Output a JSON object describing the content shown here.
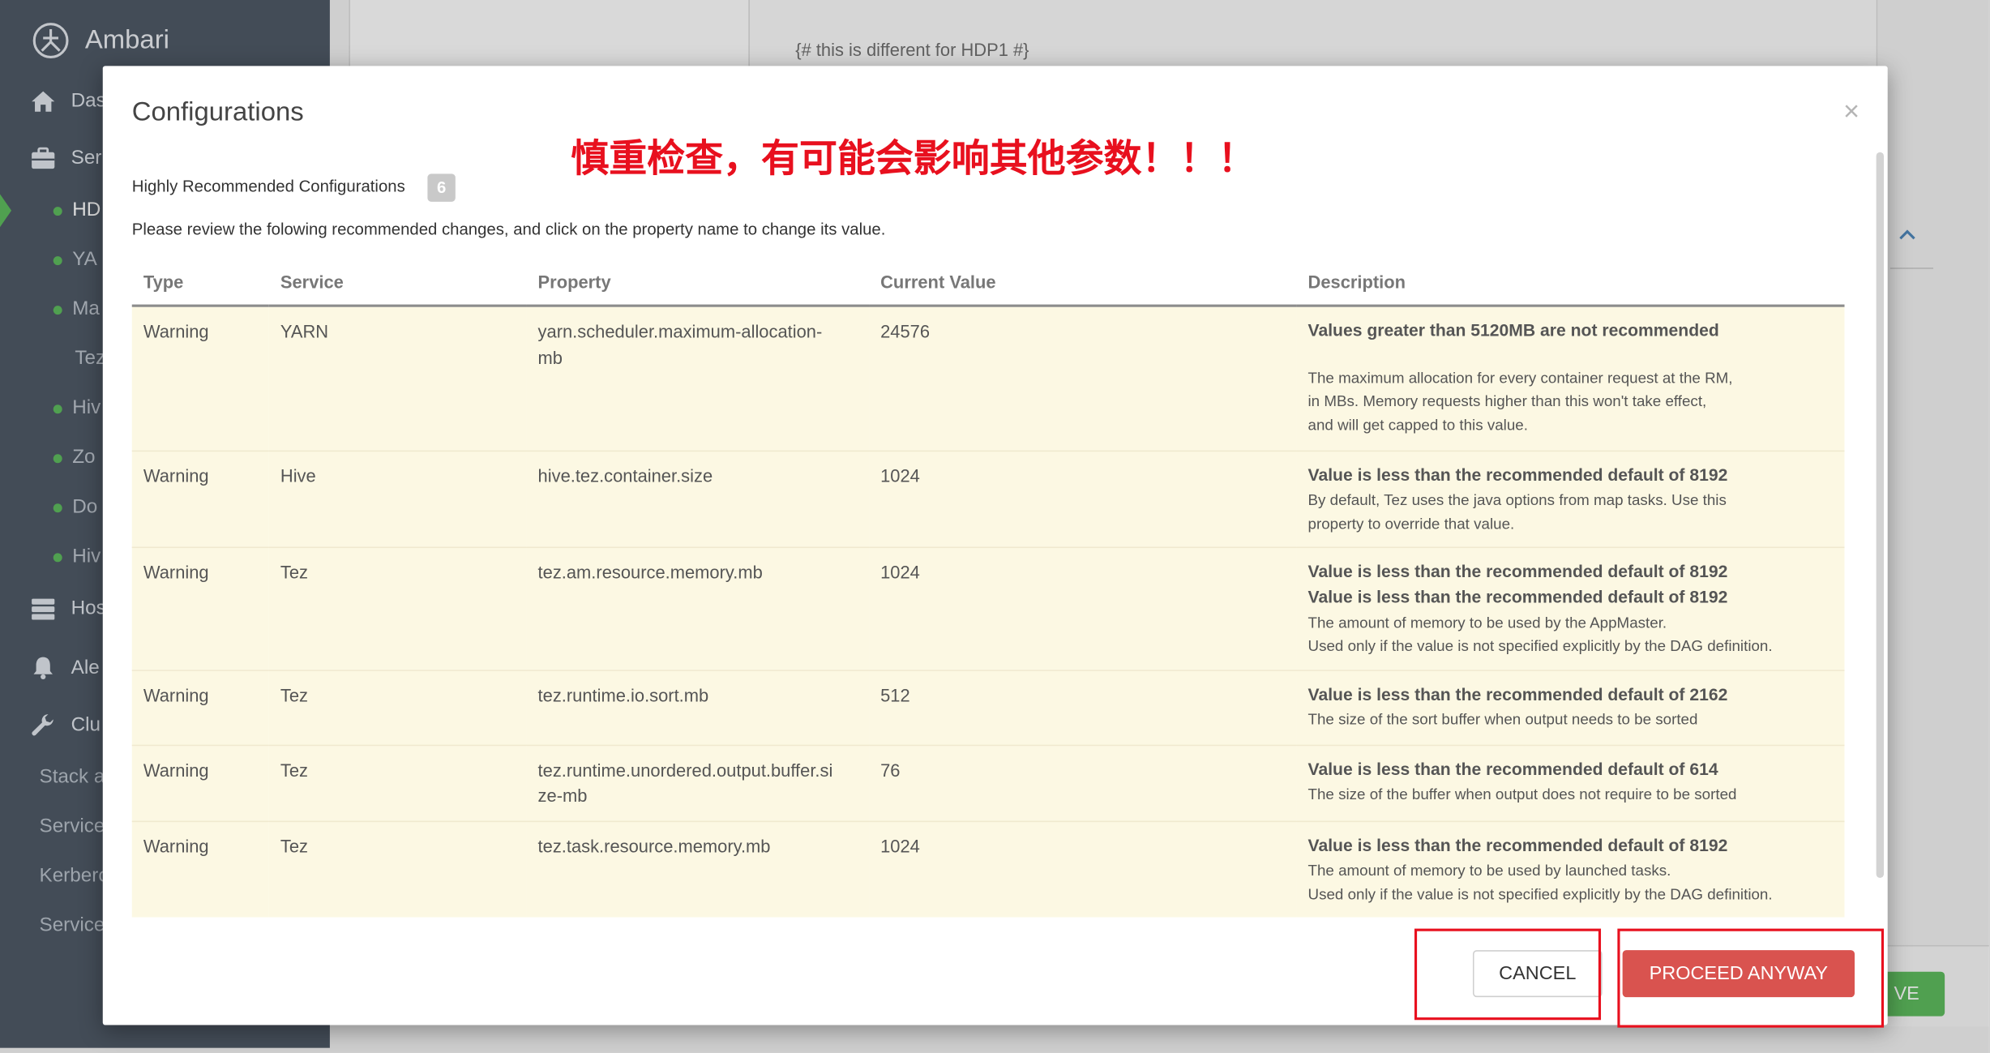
{
  "app": {
    "name": "Ambari"
  },
  "sidebar": {
    "dashboard": "Das",
    "services": "Ser",
    "service_list": [
      "HD",
      "YA",
      "Ma",
      "Tez",
      "Hiv",
      "Zo",
      "Do",
      "Hiv"
    ],
    "hosts": "Hos",
    "alerts": "Ale",
    "cluster_admin": "Clu",
    "admin_items": [
      "Stack a",
      "Service",
      "Kerbero",
      "Service"
    ]
  },
  "background": {
    "config_snippet": "{# this is different for HDP1 #}",
    "save_fragment": "VE"
  },
  "modal": {
    "title": "Configurations",
    "close": "×",
    "annotation": "慎重检查，有可能会影响其他参数！！！",
    "subtitle": "Highly Recommended Configurations",
    "count": "6",
    "instructions": "Please review the folowing recommended changes, and click on the property name to change its value.",
    "columns": [
      "Type",
      "Service",
      "Property",
      "Current Value",
      "Description"
    ],
    "rows": [
      {
        "type": "Warning",
        "service": "YARN",
        "property": "yarn.scheduler.maximum-allocation-mb",
        "current_value": "24576",
        "messages": [
          "Values greater than 5120MB are not recommended"
        ],
        "notes": [
          "The maximum allocation for every container request at the RM,",
          "in MBs. Memory requests higher than this won't take effect,",
          "and will get capped to this value."
        ]
      },
      {
        "type": "Warning",
        "service": "Hive",
        "property": "hive.tez.container.size",
        "current_value": "1024",
        "messages": [
          "Value is less than the recommended default of 8192"
        ],
        "notes": [
          "By default, Tez uses the java options from map tasks. Use this",
          "property to override that value."
        ]
      },
      {
        "type": "Warning",
        "service": "Tez",
        "property": "tez.am.resource.memory.mb",
        "current_value": "1024",
        "messages": [
          "Value is less than the recommended default of 8192",
          "Value is less than the recommended default of 8192"
        ],
        "notes": [
          "The amount of memory to be used by the AppMaster.",
          "Used only if the value is not specified explicitly by the DAG definition."
        ]
      },
      {
        "type": "Warning",
        "service": "Tez",
        "property": "tez.runtime.io.sort.mb",
        "current_value": "512",
        "messages": [
          "Value is less than the recommended default of 2162"
        ],
        "notes": [
          "The size of the sort buffer when output needs to be sorted"
        ]
      },
      {
        "type": "Warning",
        "service": "Tez",
        "property": "tez.runtime.unordered.output.buffer.size-mb",
        "current_value": "76",
        "messages": [
          "Value is less than the recommended default of 614"
        ],
        "notes": [
          "The size of the buffer when output does not require to be sorted"
        ]
      },
      {
        "type": "Warning",
        "service": "Tez",
        "property": "tez.task.resource.memory.mb",
        "current_value": "1024",
        "messages": [
          "Value is less than the recommended default of 8192"
        ],
        "notes": [
          "The amount of memory to be used by launched tasks.",
          "Used only if the value is not specified explicitly by the DAG definition."
        ]
      }
    ],
    "cancel_label": "CANCEL",
    "proceed_label": "PROCEED ANYWAY"
  },
  "colors": {
    "danger": "#d9534f",
    "annotation": "#e8101e",
    "warning_bg": "#fcf8e3",
    "status_ok": "#5cb85c",
    "sidebar_bg": "#4d5865"
  },
  "icons": {
    "logo": "ambari-logo-icon",
    "dashboard": "home-icon",
    "services": "briefcase-icon",
    "hosts": "server-icon",
    "alerts": "bell-icon",
    "cluster_admin": "wrench-icon",
    "collapse": "chevron-up-icon"
  }
}
